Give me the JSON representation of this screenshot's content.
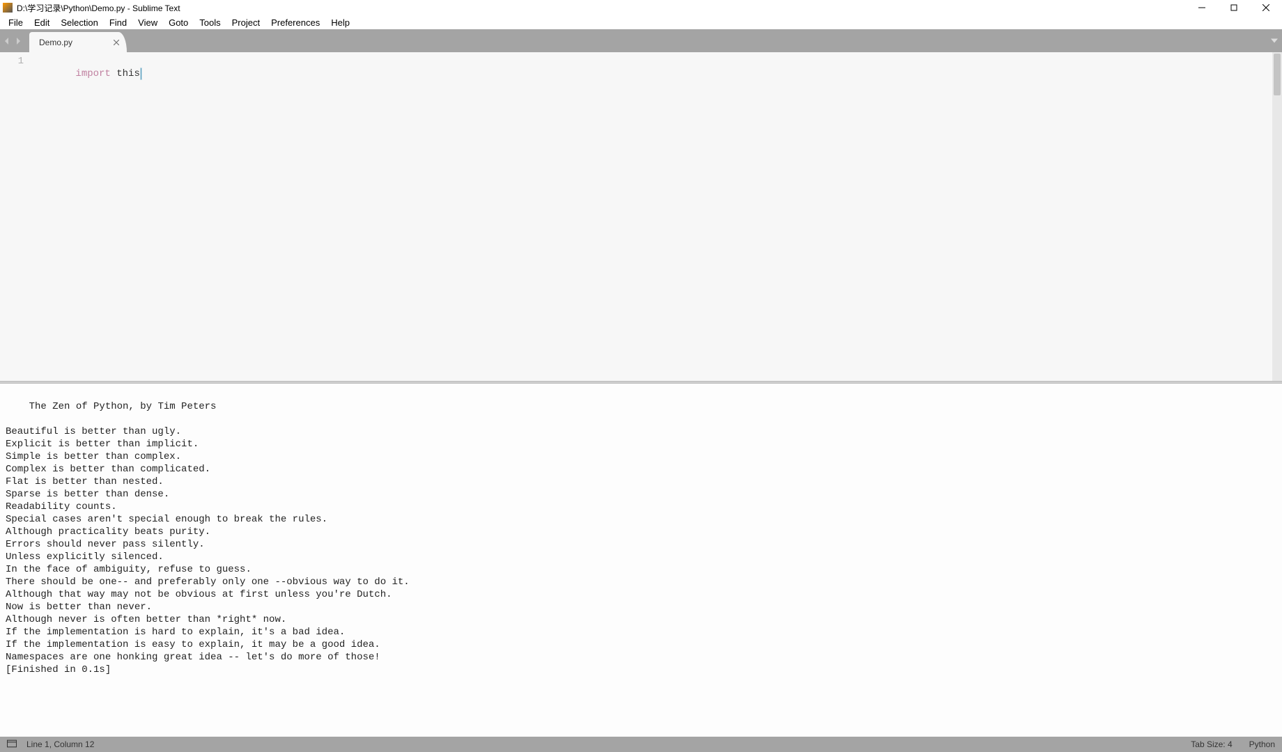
{
  "window": {
    "title": "D:\\学习记录\\Python\\Demo.py - Sublime Text"
  },
  "menu": {
    "items": [
      "File",
      "Edit",
      "Selection",
      "Find",
      "View",
      "Goto",
      "Tools",
      "Project",
      "Preferences",
      "Help"
    ]
  },
  "tabs": {
    "items": [
      {
        "label": "Demo.py"
      }
    ]
  },
  "editor": {
    "lines": [
      {
        "num": "1",
        "keyword": "import",
        "rest": " this"
      }
    ]
  },
  "output": {
    "text": "The Zen of Python, by Tim Peters\n\nBeautiful is better than ugly.\nExplicit is better than implicit.\nSimple is better than complex.\nComplex is better than complicated.\nFlat is better than nested.\nSparse is better than dense.\nReadability counts.\nSpecial cases aren't special enough to break the rules.\nAlthough practicality beats purity.\nErrors should never pass silently.\nUnless explicitly silenced.\nIn the face of ambiguity, refuse to guess.\nThere should be one-- and preferably only one --obvious way to do it.\nAlthough that way may not be obvious at first unless you're Dutch.\nNow is better than never.\nAlthough never is often better than *right* now.\nIf the implementation is hard to explain, it's a bad idea.\nIf the implementation is easy to explain, it may be a good idea.\nNamespaces are one honking great idea -- let's do more of those!\n[Finished in 0.1s]"
  },
  "status": {
    "position": "Line 1, Column 12",
    "tab_size": "Tab Size: 4",
    "syntax": "Python"
  }
}
